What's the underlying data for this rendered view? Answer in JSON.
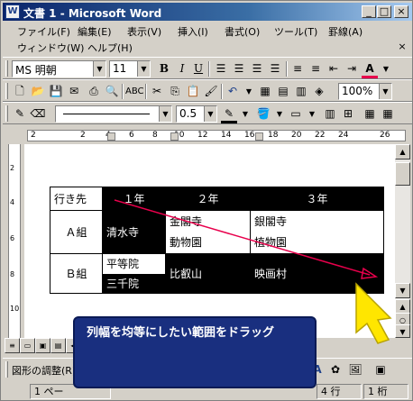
{
  "window": {
    "title": "文書 1 - Microsoft Word",
    "icon_glyph": "W"
  },
  "window_controls": {
    "minimize": "_",
    "maximize": "□",
    "close": "×"
  },
  "menu": {
    "items": [
      "ファイル(F)",
      "編集(E)",
      "表示(V)",
      "挿入(I)",
      "書式(O)",
      "ツール(T)",
      "罫線(A)",
      "ウィンドウ(W)",
      "ヘルプ(H)"
    ],
    "doc_close": "×"
  },
  "format_toolbar": {
    "font_name": "MS 明朝",
    "font_size": "11",
    "bold": "B",
    "italic": "I",
    "underline": "U"
  },
  "standard_toolbar": {
    "zoom": "100%"
  },
  "drawing_toolbar": {
    "line_weight": "0.5"
  },
  "ruler": {
    "labels": [
      "2",
      "2",
      "4",
      "6",
      "8",
      "10",
      "12",
      "14",
      "16",
      "18",
      "20",
      "22",
      "24",
      "26"
    ]
  },
  "vruler": {
    "labels": [
      "2",
      "4",
      "6",
      "8",
      "10"
    ]
  },
  "table": {
    "header": [
      "行き先",
      "１年",
      "２年",
      "３年"
    ],
    "rows": [
      {
        "group": "Ａ組",
        "c1": "清水寺",
        "c2a": "金閣寺",
        "c2b": "動物園",
        "c3a": "銀閣寺",
        "c3b": "植物園"
      },
      {
        "group": "Ｂ組",
        "c1a": "平等院",
        "c1b": "三千院",
        "c2": "比叡山",
        "c3": "映画村"
      }
    ]
  },
  "callout": {
    "text": "列幅を均等にしたい範囲をドラッグ"
  },
  "drawbar": {
    "label": "図形の調整(R)"
  },
  "status": {
    "page": "1 ペー",
    "line": "4 行",
    "col": "1 桁"
  },
  "colors": {
    "titlebar": "#0a246a",
    "callout_bg": "#192f7f",
    "arrow": "#e8004c",
    "pointer": "#ffe600"
  }
}
